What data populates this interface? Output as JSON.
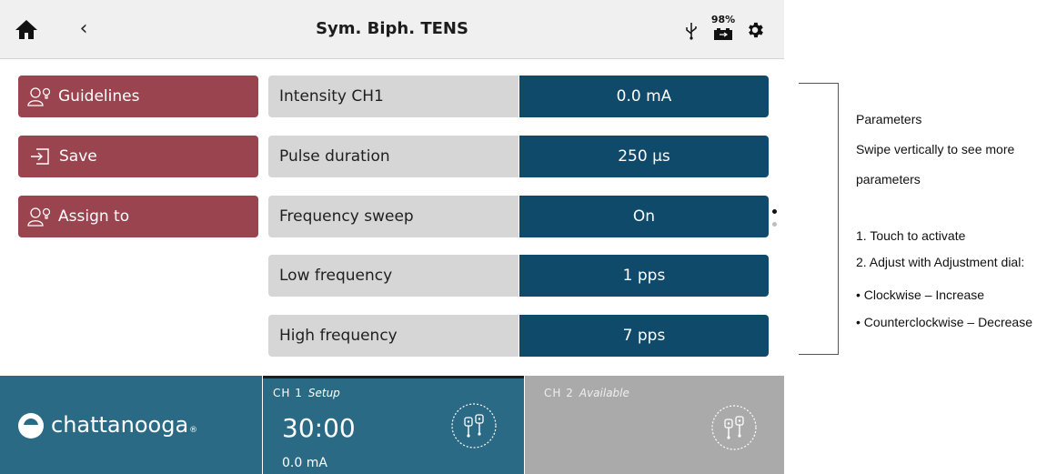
{
  "header": {
    "title": "Sym. Biph. TENS",
    "battery_percent": "98%"
  },
  "sidebar": {
    "items": [
      {
        "label": "Guidelines",
        "icon": "user-bulb-icon"
      },
      {
        "label": "Save",
        "icon": "save-icon"
      },
      {
        "label": "Assign to",
        "icon": "user-bulb-icon"
      }
    ]
  },
  "parameters": [
    {
      "name": "Intensity CH1",
      "value": "0.0 mA"
    },
    {
      "name": "Pulse duration",
      "value": "250 µs"
    },
    {
      "name": "Frequency sweep",
      "value": "On"
    },
    {
      "name": "Low frequency",
      "value": "1 pps"
    },
    {
      "name": "High frequency",
      "value": "7 pps"
    }
  ],
  "brand": {
    "name": "chattanooga",
    "reg": "®"
  },
  "channels": [
    {
      "label": "CH 1",
      "status": "Setup",
      "timer": "30:00",
      "intensity": "0.0 mA"
    },
    {
      "label": "CH 2",
      "status": "Available"
    }
  ],
  "annotation": {
    "title": "Parameters",
    "line1": "Swipe vertically to see more",
    "line2": "parameters",
    "step1": "1. Touch to activate",
    "step2": "2. Adjust with Adjustment dial:",
    "bullet1": "• Clockwise – Increase",
    "bullet2": "• Counterclockwise – Decrease"
  },
  "colors": {
    "accent_button": "#9a4450",
    "param_value_bg": "#0f4a6b",
    "param_name_bg": "#d6d6d6",
    "channel_active": "#2b6a85",
    "channel_inactive": "#aaaaaa"
  }
}
